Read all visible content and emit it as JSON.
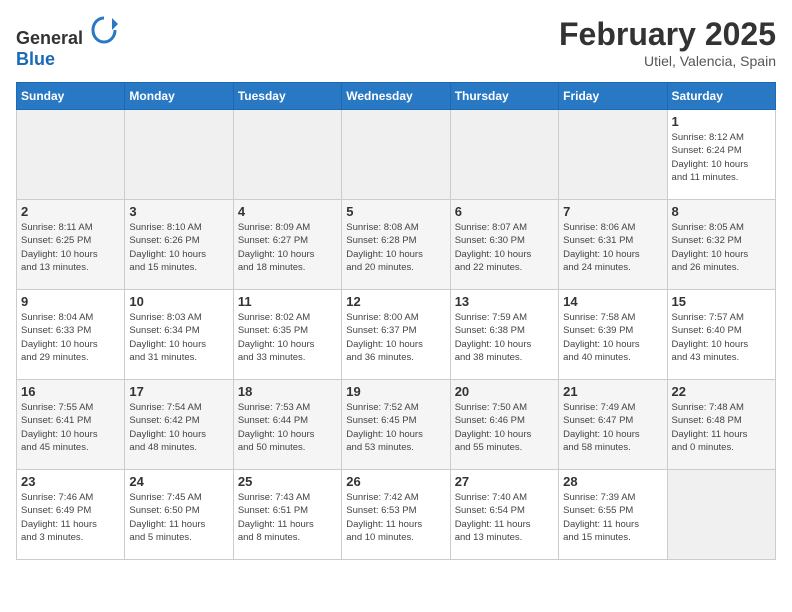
{
  "header": {
    "logo_general": "General",
    "logo_blue": "Blue",
    "month_title": "February 2025",
    "location": "Utiel, Valencia, Spain"
  },
  "weekdays": [
    "Sunday",
    "Monday",
    "Tuesday",
    "Wednesday",
    "Thursday",
    "Friday",
    "Saturday"
  ],
  "weeks": [
    [
      {
        "day": "",
        "info": ""
      },
      {
        "day": "",
        "info": ""
      },
      {
        "day": "",
        "info": ""
      },
      {
        "day": "",
        "info": ""
      },
      {
        "day": "",
        "info": ""
      },
      {
        "day": "",
        "info": ""
      },
      {
        "day": "1",
        "info": "Sunrise: 8:12 AM\nSunset: 6:24 PM\nDaylight: 10 hours\nand 11 minutes."
      }
    ],
    [
      {
        "day": "2",
        "info": "Sunrise: 8:11 AM\nSunset: 6:25 PM\nDaylight: 10 hours\nand 13 minutes."
      },
      {
        "day": "3",
        "info": "Sunrise: 8:10 AM\nSunset: 6:26 PM\nDaylight: 10 hours\nand 15 minutes."
      },
      {
        "day": "4",
        "info": "Sunrise: 8:09 AM\nSunset: 6:27 PM\nDaylight: 10 hours\nand 18 minutes."
      },
      {
        "day": "5",
        "info": "Sunrise: 8:08 AM\nSunset: 6:28 PM\nDaylight: 10 hours\nand 20 minutes."
      },
      {
        "day": "6",
        "info": "Sunrise: 8:07 AM\nSunset: 6:30 PM\nDaylight: 10 hours\nand 22 minutes."
      },
      {
        "day": "7",
        "info": "Sunrise: 8:06 AM\nSunset: 6:31 PM\nDaylight: 10 hours\nand 24 minutes."
      },
      {
        "day": "8",
        "info": "Sunrise: 8:05 AM\nSunset: 6:32 PM\nDaylight: 10 hours\nand 26 minutes."
      }
    ],
    [
      {
        "day": "9",
        "info": "Sunrise: 8:04 AM\nSunset: 6:33 PM\nDaylight: 10 hours\nand 29 minutes."
      },
      {
        "day": "10",
        "info": "Sunrise: 8:03 AM\nSunset: 6:34 PM\nDaylight: 10 hours\nand 31 minutes."
      },
      {
        "day": "11",
        "info": "Sunrise: 8:02 AM\nSunset: 6:35 PM\nDaylight: 10 hours\nand 33 minutes."
      },
      {
        "day": "12",
        "info": "Sunrise: 8:00 AM\nSunset: 6:37 PM\nDaylight: 10 hours\nand 36 minutes."
      },
      {
        "day": "13",
        "info": "Sunrise: 7:59 AM\nSunset: 6:38 PM\nDaylight: 10 hours\nand 38 minutes."
      },
      {
        "day": "14",
        "info": "Sunrise: 7:58 AM\nSunset: 6:39 PM\nDaylight: 10 hours\nand 40 minutes."
      },
      {
        "day": "15",
        "info": "Sunrise: 7:57 AM\nSunset: 6:40 PM\nDaylight: 10 hours\nand 43 minutes."
      }
    ],
    [
      {
        "day": "16",
        "info": "Sunrise: 7:55 AM\nSunset: 6:41 PM\nDaylight: 10 hours\nand 45 minutes."
      },
      {
        "day": "17",
        "info": "Sunrise: 7:54 AM\nSunset: 6:42 PM\nDaylight: 10 hours\nand 48 minutes."
      },
      {
        "day": "18",
        "info": "Sunrise: 7:53 AM\nSunset: 6:44 PM\nDaylight: 10 hours\nand 50 minutes."
      },
      {
        "day": "19",
        "info": "Sunrise: 7:52 AM\nSunset: 6:45 PM\nDaylight: 10 hours\nand 53 minutes."
      },
      {
        "day": "20",
        "info": "Sunrise: 7:50 AM\nSunset: 6:46 PM\nDaylight: 10 hours\nand 55 minutes."
      },
      {
        "day": "21",
        "info": "Sunrise: 7:49 AM\nSunset: 6:47 PM\nDaylight: 10 hours\nand 58 minutes."
      },
      {
        "day": "22",
        "info": "Sunrise: 7:48 AM\nSunset: 6:48 PM\nDaylight: 11 hours\nand 0 minutes."
      }
    ],
    [
      {
        "day": "23",
        "info": "Sunrise: 7:46 AM\nSunset: 6:49 PM\nDaylight: 11 hours\nand 3 minutes."
      },
      {
        "day": "24",
        "info": "Sunrise: 7:45 AM\nSunset: 6:50 PM\nDaylight: 11 hours\nand 5 minutes."
      },
      {
        "day": "25",
        "info": "Sunrise: 7:43 AM\nSunset: 6:51 PM\nDaylight: 11 hours\nand 8 minutes."
      },
      {
        "day": "26",
        "info": "Sunrise: 7:42 AM\nSunset: 6:53 PM\nDaylight: 11 hours\nand 10 minutes."
      },
      {
        "day": "27",
        "info": "Sunrise: 7:40 AM\nSunset: 6:54 PM\nDaylight: 11 hours\nand 13 minutes."
      },
      {
        "day": "28",
        "info": "Sunrise: 7:39 AM\nSunset: 6:55 PM\nDaylight: 11 hours\nand 15 minutes."
      },
      {
        "day": "",
        "info": ""
      }
    ]
  ]
}
